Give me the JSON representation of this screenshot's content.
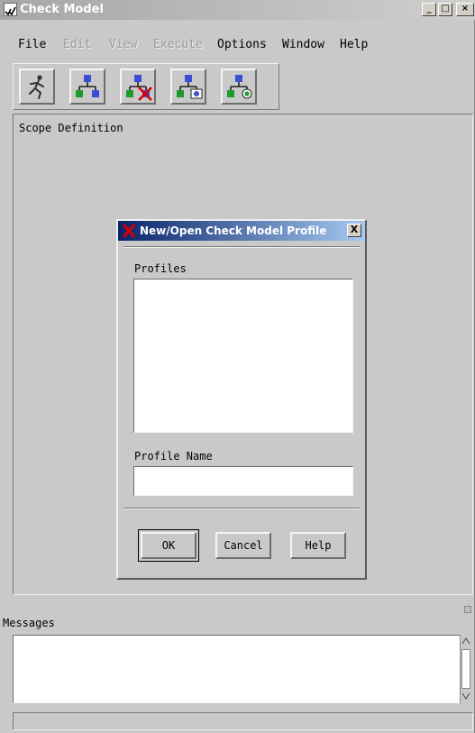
{
  "window": {
    "title": "Check Model",
    "min_label": "_",
    "max_label": "□",
    "close_label": "×"
  },
  "menu": {
    "items": [
      {
        "label": "File",
        "enabled": true
      },
      {
        "label": "Edit",
        "enabled": false
      },
      {
        "label": "View",
        "enabled": false
      },
      {
        "label": "Execute",
        "enabled": false
      },
      {
        "label": "Options",
        "enabled": true
      },
      {
        "label": "Window",
        "enabled": true
      },
      {
        "label": "Help",
        "enabled": true
      }
    ]
  },
  "toolbar": {
    "buttons": [
      {
        "icon": "run-icon"
      },
      {
        "icon": "hierarchy-icon"
      },
      {
        "icon": "hierarchy-delete-icon"
      },
      {
        "icon": "hierarchy-check-icon"
      },
      {
        "icon": "hierarchy-refresh-icon"
      }
    ]
  },
  "scope": {
    "label": "Scope Definition"
  },
  "dialog": {
    "title": "New/Open Check Model Profile",
    "close_label": "X",
    "profiles_label": "Profiles",
    "profile_name_label": "Profile Name",
    "profile_name_value": "",
    "ok_label": "OK",
    "cancel_label": "Cancel",
    "help_label": "Help"
  },
  "messages": {
    "label": "Messages",
    "text": ""
  },
  "status": {
    "text": ""
  },
  "colors": {
    "background": "#c9c9c9",
    "dialog_title_start": "#0a246a",
    "dialog_title_end": "#a6caf0",
    "icon_blue": "#3a4fd6",
    "icon_green": "#1e9a2c",
    "icon_red": "#d40000"
  }
}
